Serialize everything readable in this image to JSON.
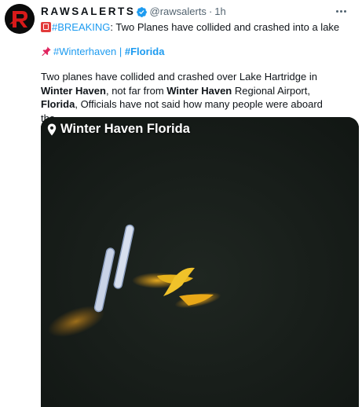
{
  "author": {
    "display_name": "RAWSALERTS",
    "handle": "@rawsalerts",
    "separator": "·",
    "time": "1h"
  },
  "headline": {
    "hashtag": "#BREAKING",
    "text": ": Two Planes have collided and crashed into a lake"
  },
  "tags": {
    "tag1": "#Winterhaven",
    "divider": "|",
    "tag2": "#Florida"
  },
  "body": {
    "p1": "Two planes have collided and crashed over Lake Hartridge in ",
    "b1": "Winter Haven",
    "p2": ", not far from ",
    "b2": "Winter Haven",
    "p3": " Regional Airport, ",
    "b3": "Florida",
    "p4": ", Officials have not said how many people were aboard the..."
  },
  "media": {
    "location_label": "Winter Haven Florida"
  },
  "colors": {
    "link": "#1d9bf0",
    "verified": "#1d9bf0",
    "water": "#171d19",
    "plane_yellow": "#e6b21c"
  },
  "icons": [
    "avatar-logo",
    "verified-icon",
    "more-icon",
    "siren-icon",
    "pushpin-icon",
    "location-pin-icon"
  ]
}
